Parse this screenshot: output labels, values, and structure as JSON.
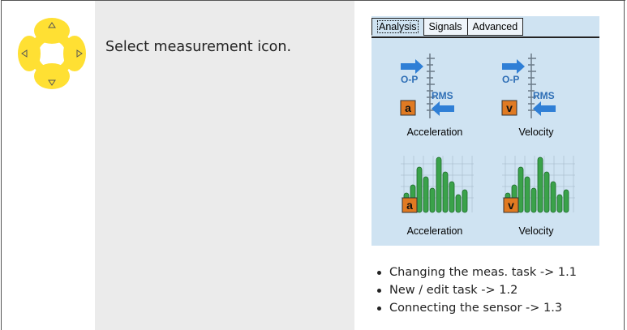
{
  "instruction": "Select measurement icon.",
  "tabs": [
    {
      "label": "Analysis",
      "active": true
    },
    {
      "label": "Signals",
      "active": false
    },
    {
      "label": "Advanced",
      "active": false
    }
  ],
  "icons": [
    {
      "name": "acceleration-overall-icon",
      "badge": "a",
      "label": "Acceleration",
      "op": "O-P",
      "rms": "RMS"
    },
    {
      "name": "velocity-overall-icon",
      "badge": "v",
      "label": "Velocity",
      "op": "O-P",
      "rms": "RMS"
    },
    {
      "name": "acceleration-spectrum-icon",
      "badge": "a",
      "label": "Acceleration"
    },
    {
      "name": "velocity-spectrum-icon",
      "badge": "v",
      "label": "Velocity"
    }
  ],
  "bullets": [
    "Changing the meas. task -> 1.1",
    "New / edit task -> 1.2",
    "Connecting the sensor -> 1.3"
  ],
  "colors": {
    "dpad": "#ffe033",
    "panel": "#cfe3f2",
    "badge": "#e07a22",
    "bars": "#3aa24a",
    "arrow": "#2f7fd6"
  }
}
